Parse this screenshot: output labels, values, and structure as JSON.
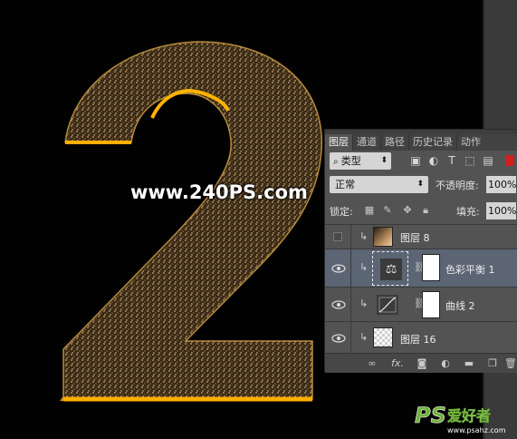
{
  "canvas": {
    "watermark": "www.240PS.com",
    "artwork": "gold glitter number 2",
    "gold_color": "#e8a400"
  },
  "logo": {
    "letters": "PS",
    "chinese": "爱好者",
    "url": "www.psahz.com"
  },
  "layers_panel": {
    "tabs": [
      {
        "label": "图层",
        "active": true
      },
      {
        "label": "通道",
        "active": false
      },
      {
        "label": "路径",
        "active": false
      },
      {
        "label": "历史记录",
        "active": false
      },
      {
        "label": "动作",
        "active": false
      }
    ],
    "filter": {
      "kind_label": "类型",
      "icons": [
        "image-filter-icon",
        "adjustment-filter-icon",
        "type-filter-icon",
        "shape-filter-icon",
        "smart-object-filter-icon"
      ]
    },
    "blend_mode": "正常",
    "opacity_label": "不透明度:",
    "opacity_value": "100%",
    "lock_label": "锁定:",
    "lock_icons": [
      "lock-transparent-icon",
      "lock-image-icon",
      "lock-position-icon",
      "lock-all-icon"
    ],
    "fill_label": "填充:",
    "fill_value": "100%",
    "layers": [
      {
        "name": "图层 8",
        "visible": false,
        "clipped": true,
        "thumb": "gradient-brown",
        "selected": false
      },
      {
        "name": "色彩平衡 1",
        "visible": true,
        "clipped": true,
        "thumb": "color-balance-adjustment",
        "selected": true
      },
      {
        "name": "曲线 2",
        "visible": true,
        "clipped": true,
        "thumb": "curves-adjustment",
        "selected": false
      },
      {
        "name": "图层 16",
        "visible": true,
        "clipped": true,
        "thumb": "transparent",
        "selected": false
      }
    ],
    "footer_icons": [
      "link-icon",
      "fx-icon",
      "add-mask-icon",
      "adjustment-icon",
      "folder-icon",
      "new-layer-icon",
      "trash-icon"
    ],
    "footer_fx_label": "fx."
  },
  "colors": {
    "panel_bg": "#535353",
    "selected_row": "#5b6574",
    "canvas_bg": "#020202"
  }
}
